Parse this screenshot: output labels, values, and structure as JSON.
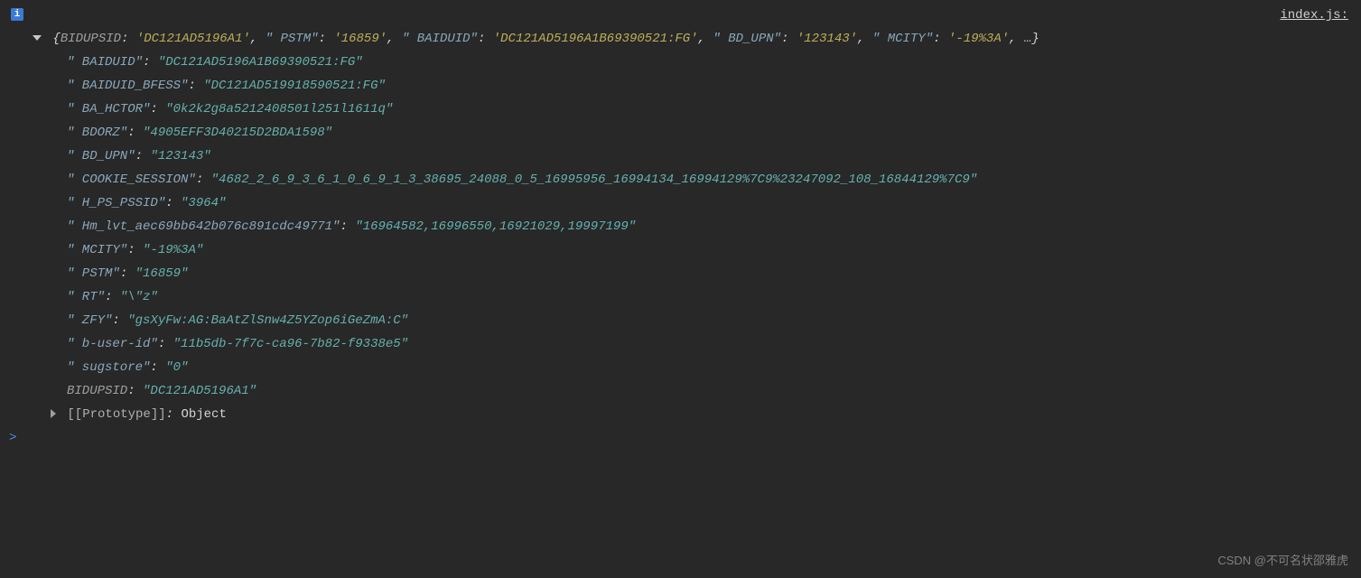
{
  "source_link": "index.js:",
  "info_badge": "i",
  "prompt_glyph": ">",
  "header": {
    "open_brace": "{",
    "close_brace": ", …}",
    "pairs": [
      {
        "k": "BIDUPSID",
        "v": "'DC121AD5196A1'",
        "unquoted": true,
        "vclass": "str-y"
      },
      {
        "k": "\" PSTM\"",
        "v": "'16859'",
        "vclass": "str-y"
      },
      {
        "k": "\" BAIDUID\"",
        "v": "'DC121AD5196A1B69390521:FG'",
        "vclass": "str-y"
      },
      {
        "k": "\" BD_UPN\"",
        "v": "'123143'",
        "vclass": "str-y"
      },
      {
        "k": "\" MCITY\"",
        "v": "'-19%3A'",
        "vclass": "str-y"
      }
    ]
  },
  "props": [
    {
      "k": "\" BAIDUID\"",
      "v": "\"DC121AD5196A1B69390521:FG\""
    },
    {
      "k": "\" BAIDUID_BFESS\"",
      "v": "\"DC121AD519918590521:FG\""
    },
    {
      "k": "\" BA_HCTOR\"",
      "v": "\"0k2k2g8a5212408501l251l1611q\""
    },
    {
      "k": "\" BDORZ\"",
      "v": "\"4905EFF3D40215D2BDA1598\""
    },
    {
      "k": "\" BD_UPN\"",
      "v": "\"123143\""
    },
    {
      "k": "\" COOKIE_SESSION\"",
      "v": "\"4682_2_6_9_3_6_1_0_6_9_1_3_38695_24088_0_5_16995956_16994134_16994129%7C9%23247092_108_16844129%7C9\""
    },
    {
      "k": "\" H_PS_PSSID\"",
      "v": "\"3964\""
    },
    {
      "k": "\" Hm_lvt_aec69bb642b076c891cdc49771\"",
      "v": "\"16964582,16996550,16921029,19997199\""
    },
    {
      "k": "\" MCITY\"",
      "v": "\"-19%3A\""
    },
    {
      "k": "\" PSTM\"",
      "v": "\"16859\""
    },
    {
      "k": "\" RT\"",
      "v": "\"\\\"z\""
    },
    {
      "k": "\" ZFY\"",
      "v": "\"gsXyFw:AG:BaAtZlSnw4Z5YZop6iGeZmA:C\""
    },
    {
      "k": "\" b-user-id\"",
      "v": "\"11b5db-7f7c-ca96-7b82-f9338e5\""
    },
    {
      "k": "\" sugstore\"",
      "v": "\"0\""
    },
    {
      "k": "BIDUPSID",
      "v": "\"DC121AD5196A1\"",
      "unquoted": true
    }
  ],
  "prototype": {
    "label": "[[Prototype]]",
    "value": "Object"
  },
  "watermark": "CSDN @不可名状邵雅虎"
}
